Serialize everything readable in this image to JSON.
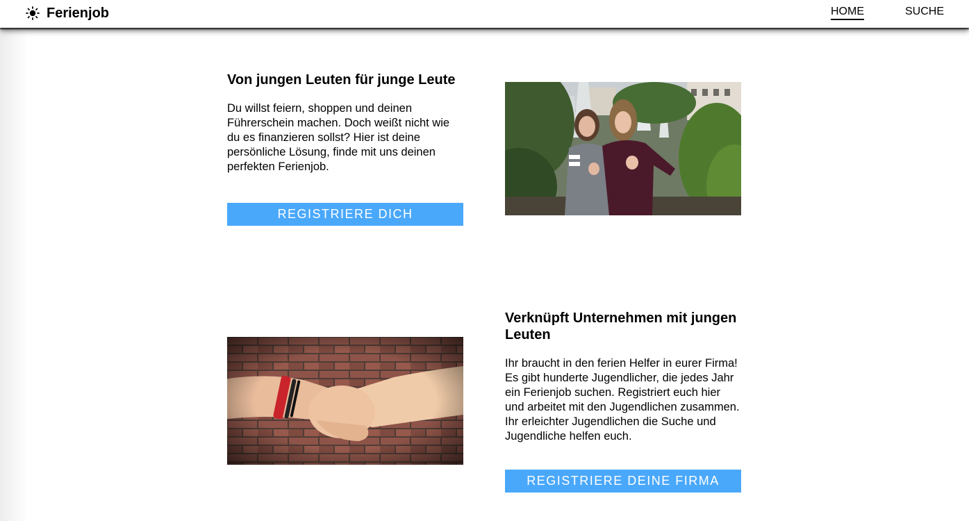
{
  "nav": {
    "brand": "Ferienjob",
    "links": [
      {
        "label": "HOME",
        "active": true
      },
      {
        "label": "SUCHE",
        "active": false
      }
    ]
  },
  "section1": {
    "heading": "Von jungen Leuten für junge Leute",
    "text": "Du willst feiern, shoppen und deinen Führerschein machen. Doch weißt nicht wie du es finanzieren sollst? Hier ist deine persönliche Lösung, finde mit uns deinen perfekten Ferienjob.",
    "button": "REGISTRIERE DICH"
  },
  "section2": {
    "heading": "Verknüpft Unternehmen mit jungen Leuten",
    "text": "Ihr braucht in den ferien Helfer in eurer Firma! Es gibt hunderte Jugendlicher, die jedes Jahr ein Ferienjob suchen. Registriert euch hier und arbeitet mit den Jugendlichen zusammen. Ihr erleichter Jugendlichen die Suche und Jugendliche helfen euch.",
    "button": "REGISTRIERE DEINE FIRMA"
  },
  "colors": {
    "accent": "#4aa8fb",
    "text": "#000000",
    "background": "#ffffff"
  },
  "icons": {
    "brand": "sun-icon"
  }
}
